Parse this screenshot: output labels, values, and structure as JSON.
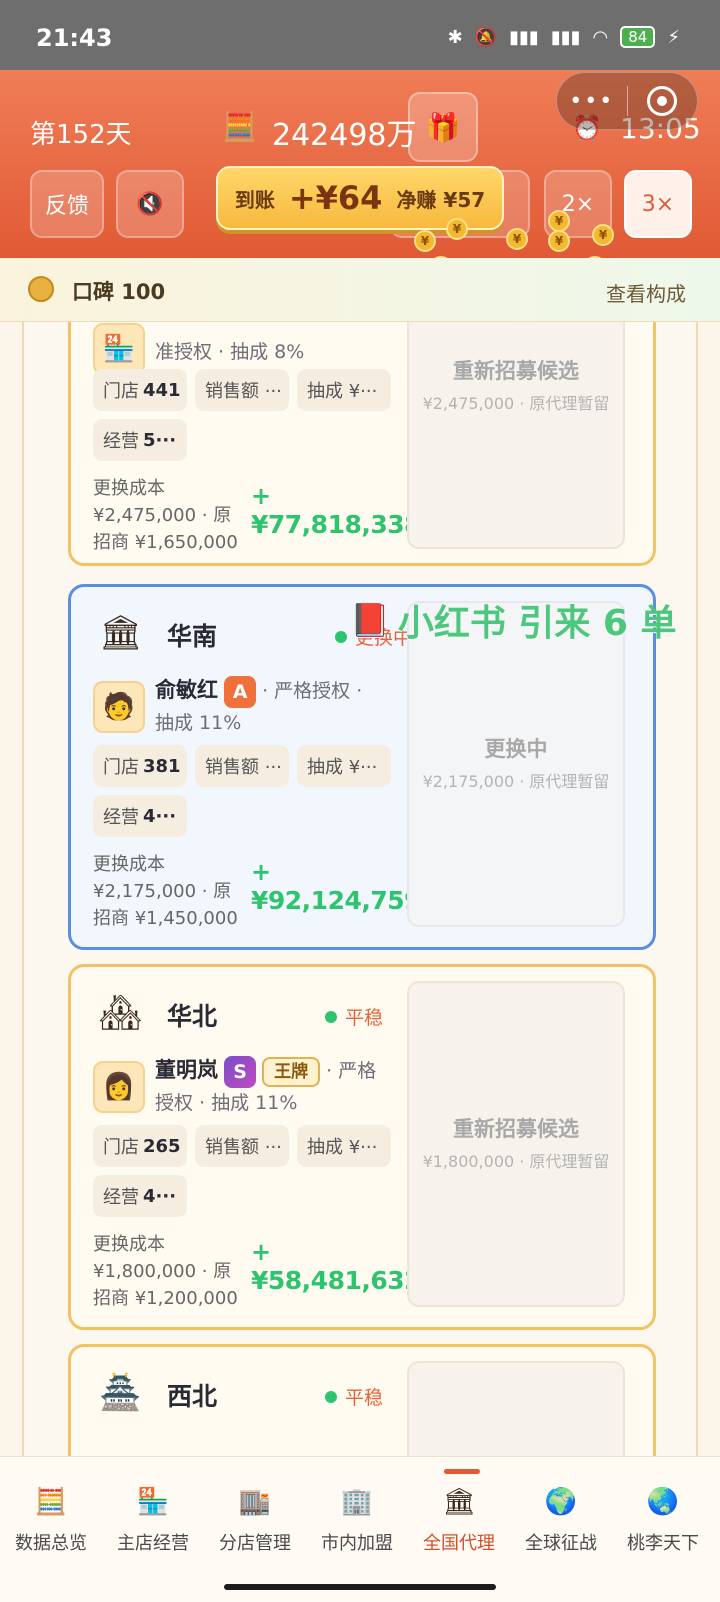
{
  "status_bar": {
    "time": "21:43",
    "battery": "84"
  },
  "header": {
    "day": "第152天",
    "money": "242498万",
    "clock": "13:05",
    "feedback_label": "反馈",
    "mute_icon": "🔇",
    "speed2": "2×",
    "speed3": "3×",
    "income_popup": {
      "label1": "到账",
      "amount": "+¥64",
      "label2": "净赚 ¥57"
    },
    "coin_symbol": "¥"
  },
  "reputation": {
    "label": "口碑 100",
    "link": "查看构成"
  },
  "cards": [
    {
      "mgr_text": "准授权 · 抽成 8%",
      "stores_label": "门店",
      "stores": "441",
      "sales_label": "销售额 ···",
      "commission_label": "抽成 ¥···",
      "ops_label": "经营",
      "ops": "5···",
      "cost_label": "更换成本",
      "cost_text": "¥2,475,000 · 原招商 ¥1,650,000",
      "plus": "+",
      "profit": "¥77,818,338",
      "side_title": "重新招募候选",
      "side_sub": "¥2,475,000 · 原代理暂留"
    },
    {
      "region": "华南",
      "status": "更换中",
      "manager": "俞敏红",
      "grade": "A",
      "mgr_text": " · 严格授权 · 抽成 11%",
      "stores_label": "门店",
      "stores": "381",
      "sales_label": "销售额 ···",
      "commission_label": "抽成 ¥···",
      "ops_label": "经营",
      "ops": "4···",
      "cost_label": "更换成本",
      "cost_text": "¥2,175,000 · 原招商 ¥1,450,000",
      "plus": "+",
      "profit": "¥92,124,759",
      "side_title": "更换中",
      "side_sub": "¥2,175,000 · 原代理暂留"
    },
    {
      "region": "华北",
      "status": "平稳",
      "manager": "董明岚",
      "grade": "S",
      "tag": "王牌",
      "mgr_text": " · 严格授权 · 抽成 11%",
      "stores_label": "门店",
      "stores": "265",
      "sales_label": "销售额 ···",
      "commission_label": "抽成 ¥···",
      "ops_label": "经营",
      "ops": "4···",
      "cost_label": "更换成本",
      "cost_text": "¥1,800,000 · 原招商 ¥1,200,000",
      "plus": "+",
      "profit": "¥58,481,632",
      "side_title": "重新招募候选",
      "side_sub": "¥1,800,000 · 原代理暂留"
    },
    {
      "region": "西北",
      "status": "平稳"
    }
  ],
  "float_text": "小红书 引来 6 单",
  "nav": [
    {
      "label": "数据总览",
      "icon": "cash-register-icon"
    },
    {
      "label": "主店经营",
      "icon": "shop-icon"
    },
    {
      "label": "分店管理",
      "icon": "branch-store-icon"
    },
    {
      "label": "市内加盟",
      "icon": "city-franchise-icon"
    },
    {
      "label": "全国代理",
      "icon": "national-agent-icon"
    },
    {
      "label": "全球征战",
      "icon": "globe-icon"
    },
    {
      "label": "桃李天下",
      "icon": "globe-stand-icon"
    }
  ],
  "nav_active": "全国代理"
}
